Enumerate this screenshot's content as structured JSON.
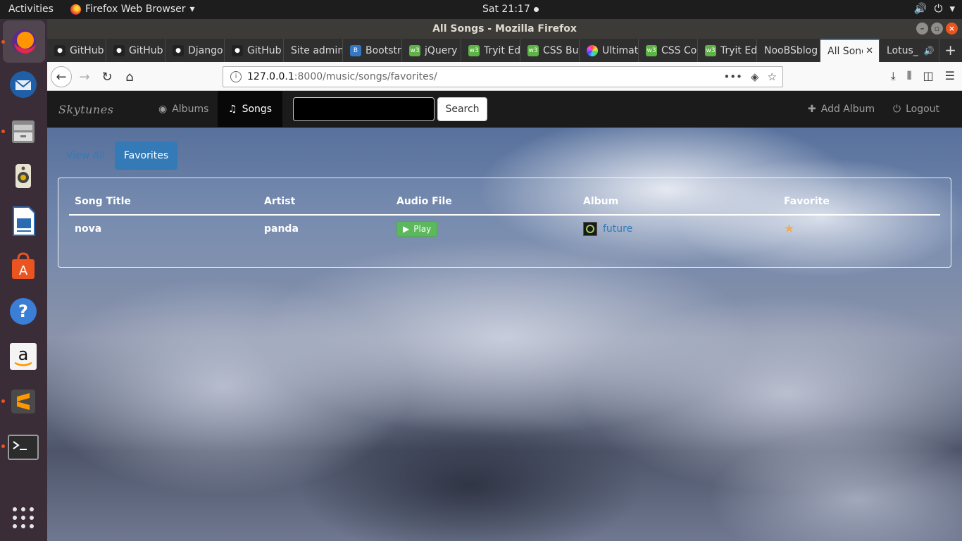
{
  "topbar": {
    "activities": "Activities",
    "app_name": "Firefox Web Browser",
    "clock": "Sat 21:17"
  },
  "window": {
    "title": "All Songs - Mozilla Firefox"
  },
  "tabs": [
    {
      "label": "GitHub",
      "icon": "github-icon"
    },
    {
      "label": "GitHub",
      "icon": "github-icon"
    },
    {
      "label": "Django",
      "icon": "github-icon"
    },
    {
      "label": "GitHub",
      "icon": "github-icon"
    },
    {
      "label": "Site admin",
      "icon": "none"
    },
    {
      "label": "Bootstrap",
      "icon": "bootstrap-icon"
    },
    {
      "label": "jQuery",
      "icon": "w3schools-icon"
    },
    {
      "label": "Tryit Editor",
      "icon": "w3schools-icon"
    },
    {
      "label": "CSS Buttons",
      "icon": "w3schools-icon"
    },
    {
      "label": "Ultimate",
      "icon": "color-wheel-icon"
    },
    {
      "label": "CSS Colors",
      "icon": "w3schools-icon"
    },
    {
      "label": "Tryit Editor",
      "icon": "w3schools-icon"
    },
    {
      "label": "NooBSblog",
      "icon": "none"
    },
    {
      "label": "All Songs",
      "icon": "none",
      "active": true
    },
    {
      "label": "Lotus_",
      "icon": "none"
    }
  ],
  "url": {
    "host": "127.0.0.1",
    "path": ":8000/music/songs/favorites/"
  },
  "app": {
    "brand": "Skytunes",
    "nav_albums": "Albums",
    "nav_songs": "Songs",
    "search_placeholder": "",
    "search_button": "Search",
    "add_album": "Add Album",
    "logout": "Logout"
  },
  "filters": {
    "view_all": "View All",
    "favorites": "Favorites"
  },
  "table": {
    "headers": [
      "Song Title",
      "Artist",
      "Audio File",
      "Album",
      "Favorite"
    ],
    "rows": [
      {
        "title": "nova",
        "artist": "panda",
        "play": "Play",
        "album": "future",
        "favorite": true
      }
    ]
  },
  "colors": {
    "accent": "#337ab7",
    "play": "#5cb85c",
    "star": "#f0ad4e"
  }
}
